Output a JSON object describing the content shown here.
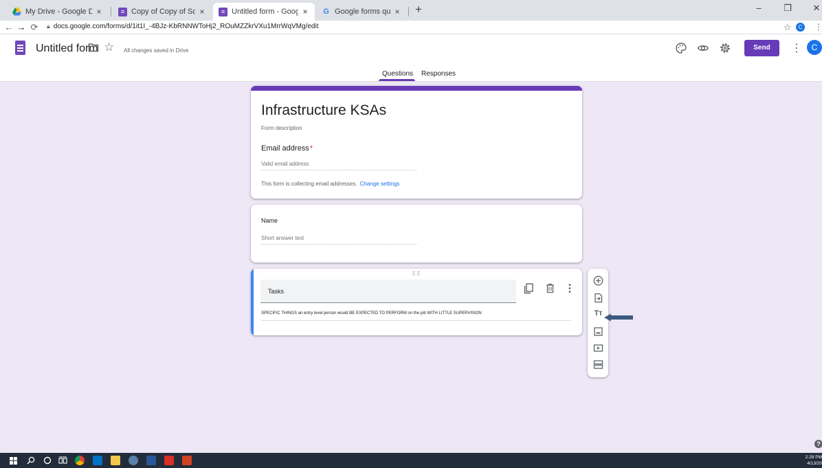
{
  "browser": {
    "tabs": [
      {
        "label": "My Drive - Google Drive",
        "active": false
      },
      {
        "label": "Copy of Copy of Software Dev K",
        "active": false
      },
      {
        "label": "Untitled form - Google Forms",
        "active": true
      },
      {
        "label": "Google forms question icons - G",
        "active": false
      }
    ],
    "close_glyph": "×",
    "new_tab_glyph": "+",
    "url": "docs.google.com/forms/d/1it1I_-4BJz-KbRNNWToHj2_ROuMZZkrVXu1MrrWqVMg/edit",
    "profile_initial": "C"
  },
  "header": {
    "doc_title": "Untitled form",
    "save_status": "All changes saved in Drive",
    "send_label": "Send",
    "avatar_initial": "C",
    "tabs": [
      {
        "label": "Questions",
        "active": true
      },
      {
        "label": "Responses",
        "active": false
      }
    ]
  },
  "form": {
    "title": "Infrastructure KSAs",
    "description_placeholder": "Form description",
    "email": {
      "label": "Email address",
      "required_mark": "*",
      "placeholder": "Valid email address",
      "note": "This form is collecting email addresses.",
      "change_link": "Change settings"
    },
    "questions": [
      {
        "title": "Name",
        "answer_placeholder": "Short answer text"
      }
    ],
    "section": {
      "title": "Tasks",
      "description": "SPECIFIC THINGS an entry level person would BE EXPECTED TO PERFORM on the job WITH LITTLE SUPERVISION"
    }
  },
  "toolbar": {
    "text_icon_glyph": "Tт"
  },
  "taskbar": {
    "time": "2:28 PM",
    "date": "4/13/20"
  },
  "colors": {
    "accent": "#673ab7",
    "page_bg": "#ede7f6",
    "active_border": "#4285f4",
    "link": "#1a73e8",
    "required": "#d93025",
    "pointer_arrow": "#3d5a80"
  }
}
